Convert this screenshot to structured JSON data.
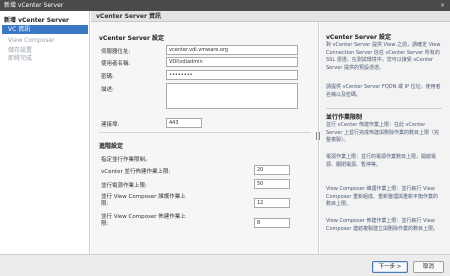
{
  "window": {
    "title": "新增 vCenter Server",
    "close_glyph": "×"
  },
  "sidebar": {
    "items": [
      {
        "label": "新增 vCenter Server",
        "state": "group"
      },
      {
        "label": "VC 資訊",
        "state": "active"
      },
      {
        "label": "View Composer",
        "state": "disabled"
      },
      {
        "label": "儲存設置",
        "state": "disabled"
      },
      {
        "label": "即將完成",
        "state": "disabled"
      }
    ]
  },
  "header": {
    "title": "vCenter Server 資訊"
  },
  "form": {
    "section_title": "vCenter Server 設定",
    "fields": {
      "server_address": {
        "label": "伺服器位址:",
        "value": "vcenter.vdi.vmware.org"
      },
      "username": {
        "label": "使用者名稱:",
        "value": "VDI\\vdiadmin"
      },
      "password": {
        "label": "密碼:",
        "value": "••••••••"
      },
      "description": {
        "label": "描述:",
        "value": ""
      },
      "port": {
        "label": "連接埠:",
        "value": "443"
      }
    },
    "advanced": {
      "title": "進階設定",
      "subtitle": "指定並行作業限制。",
      "limits": [
        {
          "label": "vCenter 並行佈建作業上限:",
          "value": "20"
        },
        {
          "label": "並行電源作業上限:",
          "value": "50"
        },
        {
          "label": "並行 View Composer 維護作業上\n限:",
          "value": "12"
        },
        {
          "label": "並行 View Composer 佈建作業上\n限:",
          "value": "8"
        }
      ]
    }
  },
  "help": {
    "title1": "vCenter Server 設定",
    "para1": "對 vCenter Server 提供 View 之前，請確定 View Connection Server 信任 vCenter Server 所有的 SSL 憑證。在測試環境中，您可以接受 vCenter Server 提供的預設憑證。",
    "para2": "請提供 vCenter Server FQDN 或 IP 位址，使用者名稱以及密碼。",
    "title2": "並行作業限制",
    "para3": "並行 vCenter 佈建作業上限：在此 vCenter Server 上並行完成佈建與刪除作業的數目上限（完整複製）。",
    "para4": "電源作業上限：並行的電源作業數目上限，開啟電源、關閉電源、暫停等。",
    "para5": "View Composer 維護作業上限：並行執行 View Composer 重新組成、重新整理與重新平衡作業的數目上限。",
    "para6": "View Composer 佈建作業上限：並行執行 View Composer 連結複製建立與刪除作業的數目上限。"
  },
  "footer": {
    "next_label": "下一步 >",
    "cancel_label": "取消"
  }
}
